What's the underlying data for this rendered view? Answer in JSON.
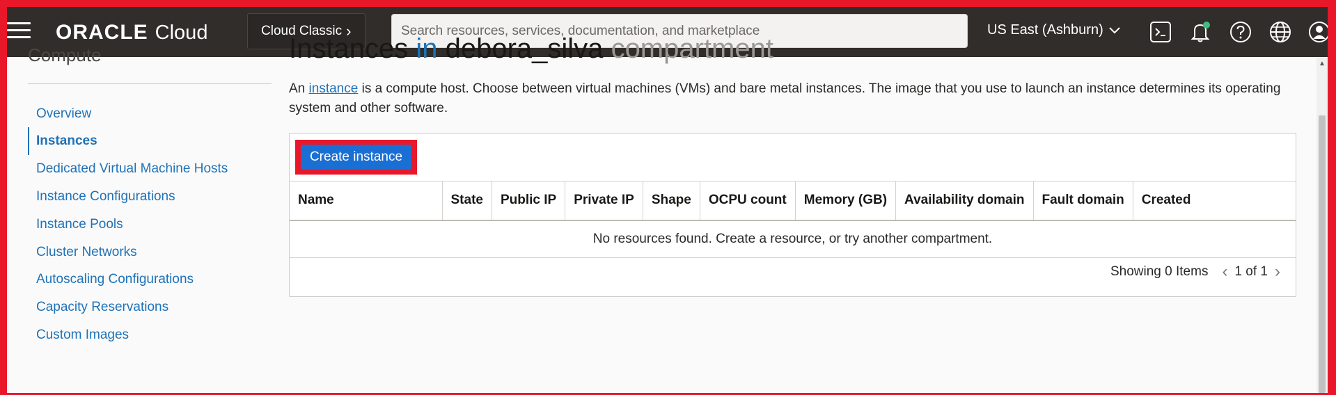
{
  "topbar": {
    "brand": "ORACLE",
    "product": "Cloud",
    "console_switch": "Cloud Classic",
    "search_placeholder": "Search resources, services, documentation, and marketplace",
    "region": "US East (Ashburn)",
    "icons": [
      "menu-icon",
      "cloud-shell-icon",
      "bell-icon",
      "help-icon",
      "globe-icon",
      "user-icon"
    ],
    "notification_dot_color": "#3fbf7f"
  },
  "sidebar": {
    "heading": "Compute",
    "items": [
      {
        "label": "Overview",
        "active": false
      },
      {
        "label": "Instances",
        "active": true
      },
      {
        "label": "Dedicated Virtual Machine Hosts",
        "active": false
      },
      {
        "label": "Instance Configurations",
        "active": false
      },
      {
        "label": "Instance Pools",
        "active": false
      },
      {
        "label": "Cluster Networks",
        "active": false
      },
      {
        "label": "Autoscaling Configurations",
        "active": false
      },
      {
        "label": "Capacity Reservations",
        "active": false
      },
      {
        "label": "Custom Images",
        "active": false
      }
    ]
  },
  "main": {
    "title": {
      "prefix": "Instances",
      "in": "in",
      "compartment_name": "debora_silva",
      "suffix": "compartment"
    },
    "description": {
      "before": "An ",
      "link": "instance",
      "after": " is a compute host. Choose between virtual machines (VMs) and bare metal instances. The image that you use to launch an instance determines its operating system and other software."
    },
    "create_button": "Create instance",
    "table": {
      "columns": [
        "Name",
        "State",
        "Public IP",
        "Private IP",
        "Shape",
        "OCPU count",
        "Memory (GB)",
        "Availability domain",
        "Fault domain",
        "Created"
      ],
      "empty_message": "No resources found. Create a resource, or try another compartment."
    },
    "pager": {
      "showing": "Showing 0 Items",
      "page": "1 of 1"
    }
  },
  "colors": {
    "topbar_bg": "#312d2a",
    "link_blue": "#1e72b8",
    "button_blue": "#1a6fd4",
    "highlight_red": "#e8172a"
  }
}
